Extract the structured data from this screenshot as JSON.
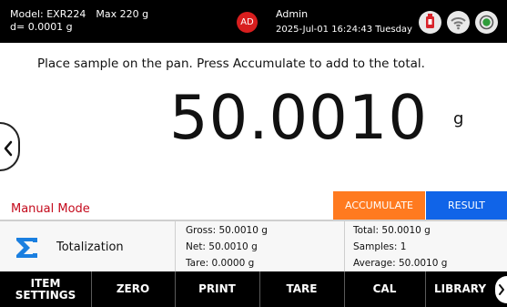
{
  "status": {
    "model_line": "Model: EXR224",
    "max_line": "Max 220 g",
    "d_line": "d= 0.0001 g",
    "avatar_initials": "AD",
    "avatar_color": "#d81e1e",
    "user_name": "Admin",
    "datetime": "2025-Jul-01 16:24:43 Tuesday",
    "icons": [
      "usb-icon",
      "wifi-icon",
      "target-icon"
    ]
  },
  "main": {
    "instruction": "Place sample on the pan. Press Accumulate to add to the total.",
    "weight": "50.0010",
    "unit": "g",
    "mode": "Manual Mode",
    "mode_color": "#c40a1c",
    "accumulate_label": "ACCUMULATE",
    "accumulate_color": "#ff7a1f",
    "result_label": "RESULT",
    "result_color": "#1064e8"
  },
  "info": {
    "title": "Totalization",
    "gross": "Gross: 50.0010 g",
    "net": "Net: 50.0010 g",
    "tare": "Tare: 0.0000 g",
    "total": "Total: 50.0010 g",
    "samples": "Samples: 1",
    "average": "Average: 50.0010 g"
  },
  "toolbar": {
    "item_settings_line1": "ITEM",
    "item_settings_line2": "SETTINGS",
    "zero": "ZERO",
    "print": "PRINT",
    "tare": "TARE",
    "cal": "CAL",
    "library": "LIBRARY"
  }
}
